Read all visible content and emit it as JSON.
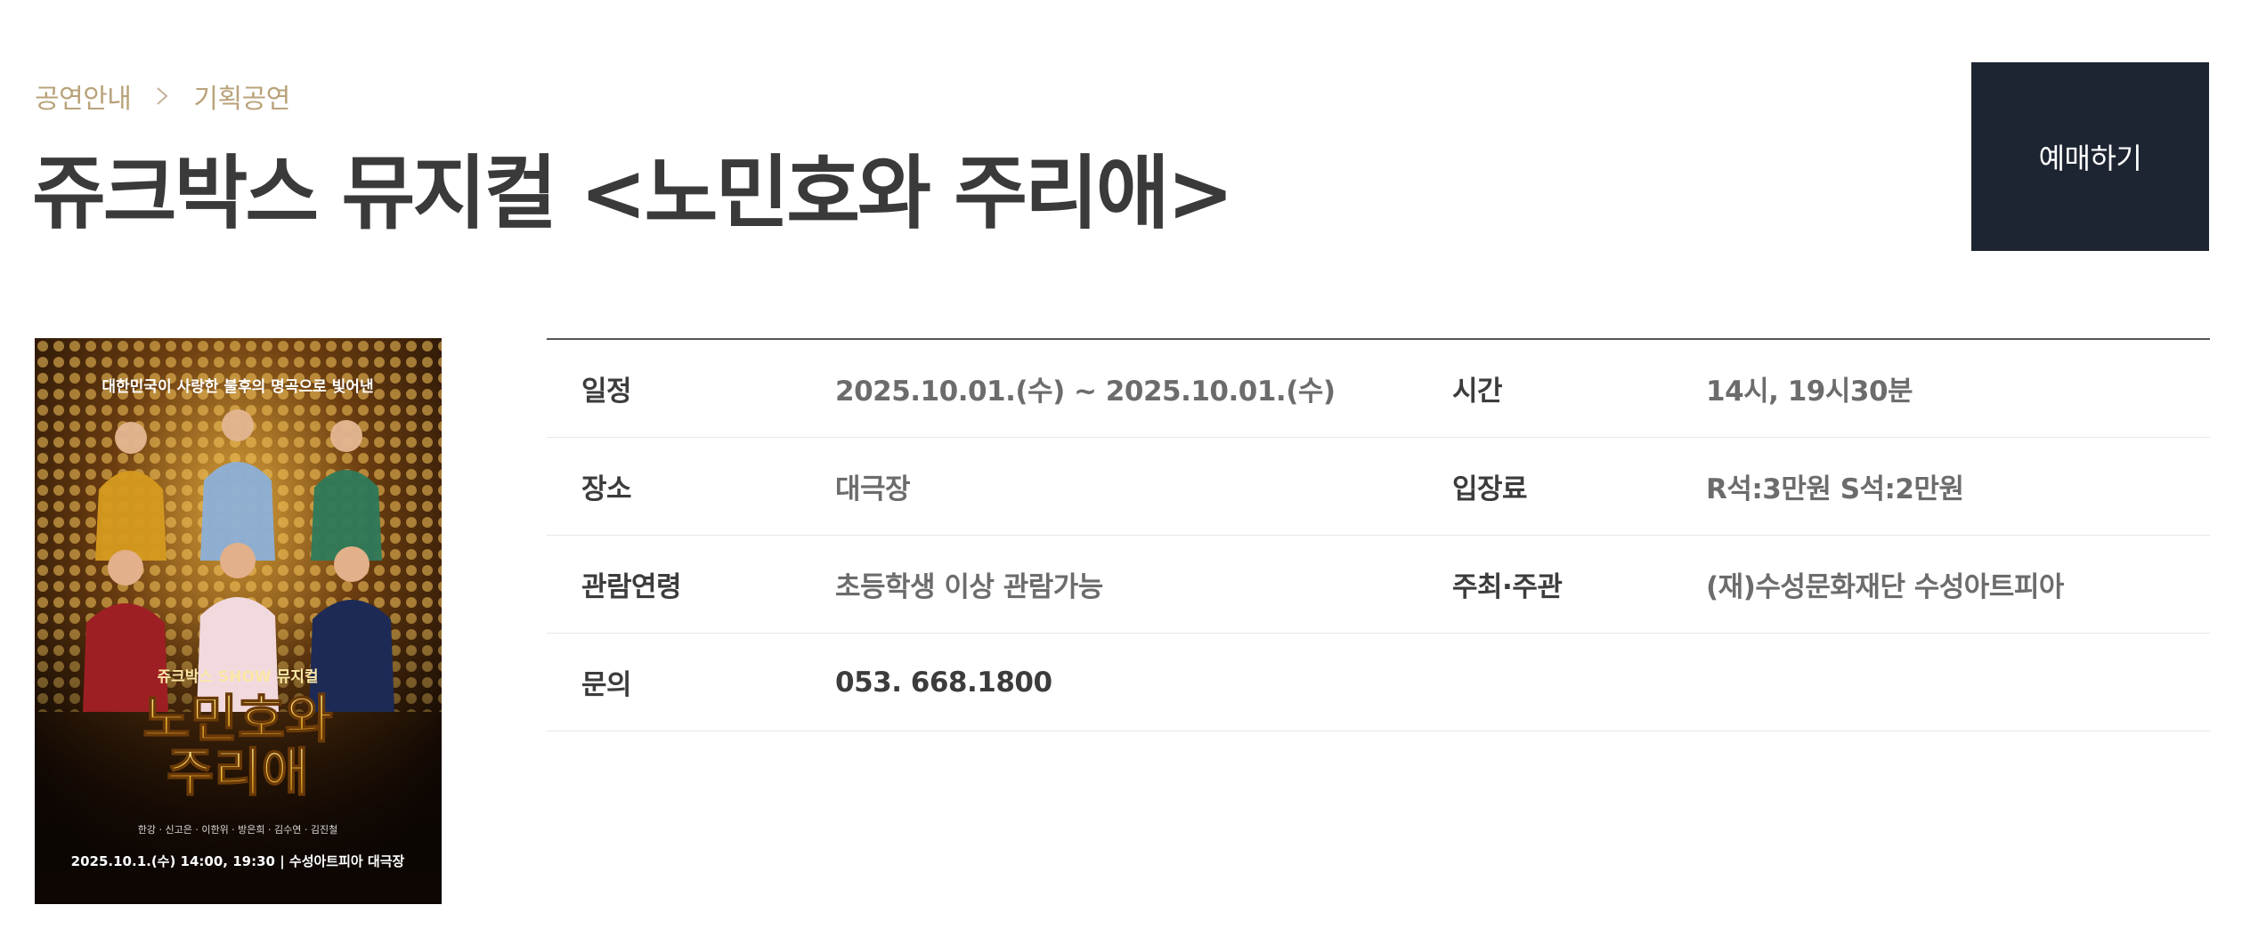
{
  "breadcrumb": {
    "items": [
      "공연안내",
      "기획공연"
    ]
  },
  "page_title": "쥬크박스 뮤지컬 <노민호와 주리애>",
  "reserve_button": "예매하기",
  "poster": {
    "tagline": "대한민국이 사랑한 불후의 명곡으로 빛어낸",
    "subtitle": "쥬크박스 SHOW 뮤지컬",
    "title_line1": "노민호와",
    "title_line2": "주리애",
    "cast": "한강 · 신고은 · 이한위 · 방은희 · 김수연 · 김진철",
    "schedule": "2025.10.1.(수) 14:00, 19:30 | 수성아트피아 대극장"
  },
  "info": {
    "rows": [
      {
        "label1": "일정",
        "value1": "2025.10.01.(수) ~ 2025.10.01.(수)",
        "label2": "시간",
        "value2": "14시, 19시30분"
      },
      {
        "label1": "장소",
        "value1": "대극장",
        "label2": "입장료",
        "value2": "R석:3만원 S석:2만원"
      },
      {
        "label1": "관람연령",
        "value1": "초등학생 이상 관람가능",
        "label2": "주최·주관",
        "value2": "(재)수성문화재단 수성아트피아"
      },
      {
        "label1": "문의",
        "value1": "053. 668.1800",
        "label2": "",
        "value2": ""
      }
    ]
  }
}
